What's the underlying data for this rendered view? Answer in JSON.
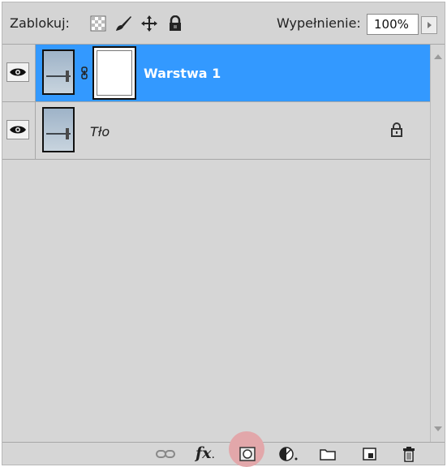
{
  "toolbar": {
    "lock_label": "Zablokuj:",
    "fill_label": "Wypełnienie:",
    "fill_value": "100%",
    "lock_icons": [
      "lock-transparent-icon",
      "lock-brush-icon",
      "lock-move-icon",
      "lock-all-icon"
    ]
  },
  "layers": [
    {
      "name": "Warstwa 1",
      "selected": true,
      "visible": true,
      "has_mask": true,
      "locked": false
    },
    {
      "name": "Tło",
      "selected": false,
      "visible": true,
      "has_mask": false,
      "locked": true
    }
  ],
  "bottom_icons": [
    "link-layers-icon",
    "fx-icon",
    "add-mask-icon",
    "adjustment-layer-icon",
    "new-group-icon",
    "new-layer-icon",
    "trash-icon"
  ],
  "bottom_fx_text": "fx",
  "colors": {
    "selected_row": "#3399ff",
    "panel_bg": "#d6d6d6",
    "mask_highlight": "#e2a7aa"
  }
}
